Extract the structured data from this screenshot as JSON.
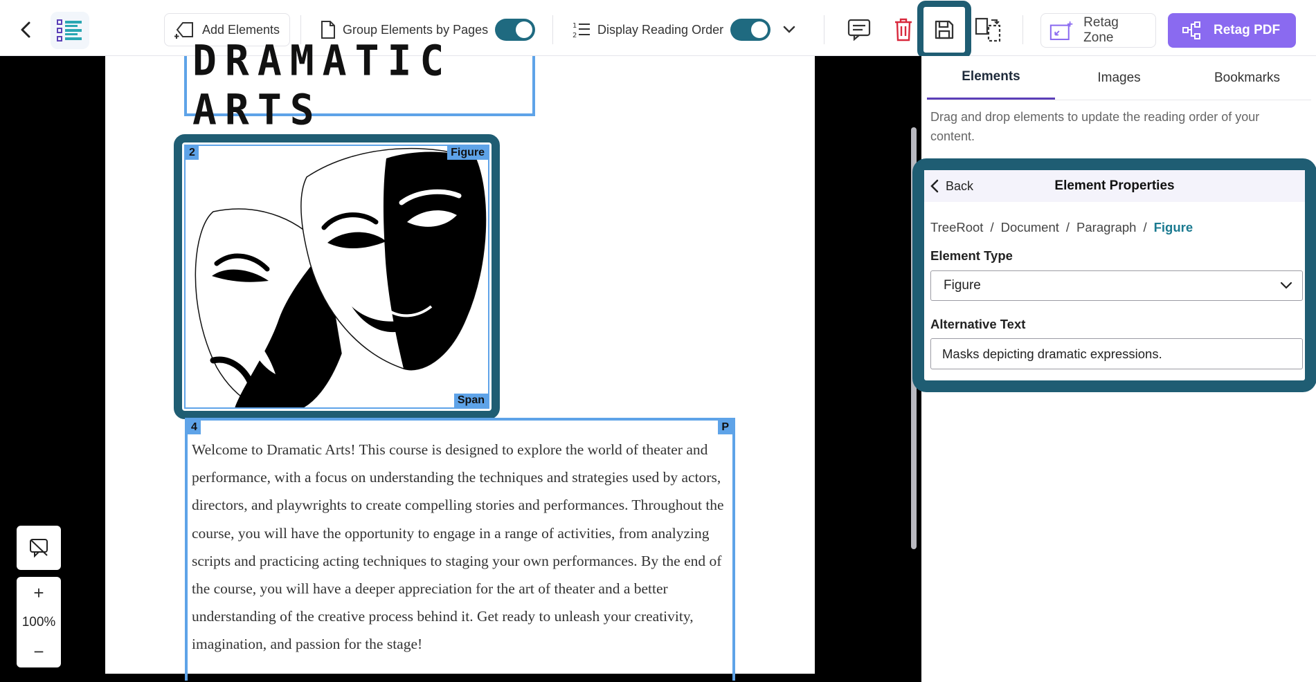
{
  "toolbar": {
    "add_elements": "Add Elements",
    "group_by_pages": "Group Elements by Pages",
    "display_reading_order": "Display Reading Order",
    "retag_zone": "Retag Zone",
    "retag_pdf": "Retag PDF"
  },
  "document": {
    "title": "DRAMATIC ARTS",
    "figure_tag": "Figure",
    "figure_number": "2",
    "span_tag": "Span",
    "para_number": "4",
    "para_tag": "P",
    "paragraph": "Welcome to Dramatic Arts! This course is designed to explore the world of theater and performance, with a focus on understanding the techniques and strategies used by actors, directors, and playwrights to create compelling stories and performances. Throughout the course, you will have the opportunity to engage in a range of activities, from analyzing scripts and practicing acting techniques to staging your own performances. By the end of the course, you will have a deeper appreciation for the art of theater and a better understanding of the creative process behind it. Get ready to unleash your creativity, imagination, and passion for the stage!"
  },
  "zoom": {
    "level": "100%"
  },
  "panel": {
    "tabs": [
      "Elements",
      "Images",
      "Bookmarks"
    ],
    "hint": "Drag and drop elements to update the reading order of your content.",
    "properties": {
      "back": "Back",
      "title": "Element Properties",
      "breadcrumb": [
        "TreeRoot",
        "Document",
        "Paragraph",
        "Figure"
      ],
      "element_type_label": "Element Type",
      "element_type_value": "Figure",
      "alt_text_label": "Alternative Text",
      "alt_text_value": "Masks depicting dramatic expressions."
    }
  },
  "colors": {
    "accent": "#1f5d73",
    "toggle": "#1f6a80",
    "primary": "#8a6af0",
    "tag": "#5ea3e8",
    "delete": "#d8283c"
  }
}
